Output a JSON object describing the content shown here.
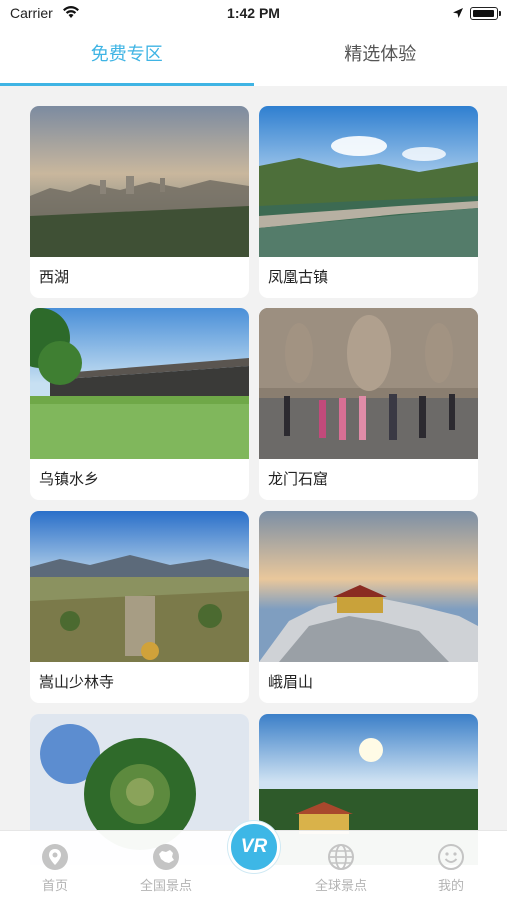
{
  "status_bar": {
    "carrier": "Carrier",
    "time": "1:42 PM"
  },
  "tabs": [
    {
      "label": "免费专区",
      "active": true
    },
    {
      "label": "精选体验",
      "active": false
    }
  ],
  "spots": [
    {
      "name": "西湖"
    },
    {
      "name": "凤凰古镇"
    },
    {
      "name": "乌镇水乡"
    },
    {
      "name": "龙门石窟"
    },
    {
      "name": "嵩山少林寺"
    },
    {
      "name": "峨眉山"
    },
    {
      "name": ""
    },
    {
      "name": ""
    }
  ],
  "bottom_nav": {
    "items": [
      {
        "label": "首页",
        "icon": "location-pin-icon"
      },
      {
        "label": "全国景点",
        "icon": "china-map-icon"
      },
      {
        "label": "全球景点",
        "icon": "globe-icon"
      },
      {
        "label": "我的",
        "icon": "smiley-icon"
      }
    ],
    "center_button": "VR"
  },
  "colors": {
    "accent": "#3fb4e4",
    "inactive": "#b3b3b3"
  }
}
